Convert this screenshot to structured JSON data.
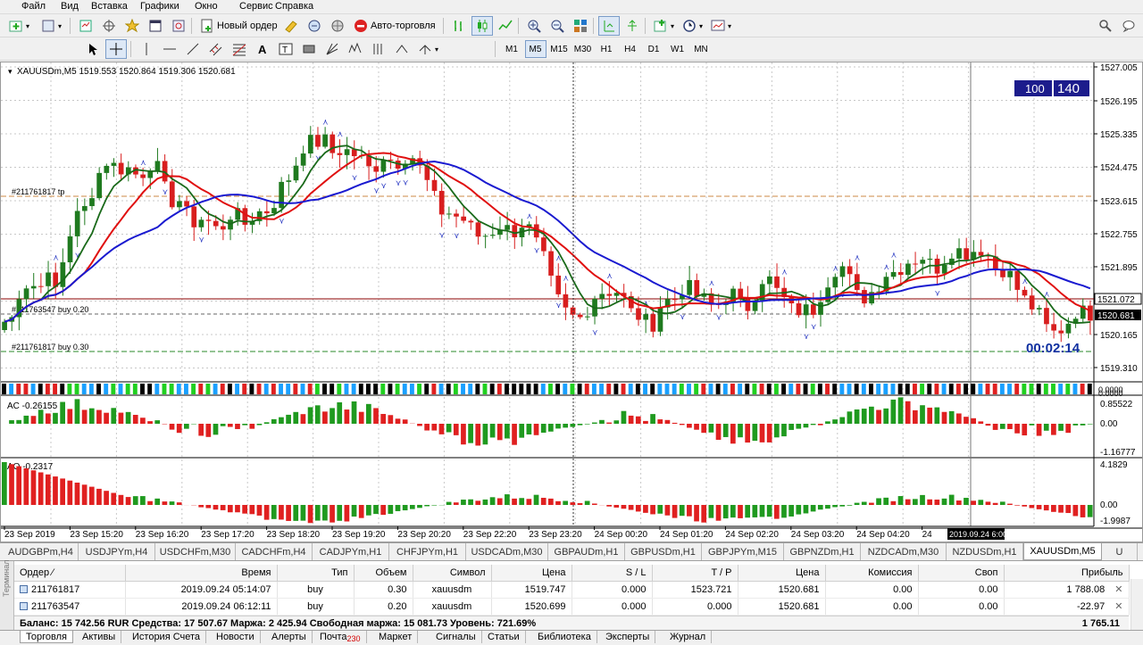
{
  "menu": [
    "Файл",
    "Вид",
    "Вставка",
    "Графики",
    "Окно",
    "Сервис",
    "Справка"
  ],
  "toolbar": {
    "new_order": "Новый ордер",
    "auto_trading": "Авто-торговля",
    "timeframes": [
      "M1",
      "M5",
      "M15",
      "M30",
      "H1",
      "H4",
      "D1",
      "W1",
      "MN"
    ],
    "active_timeframe": "M5"
  },
  "chart": {
    "header": "XAUUSDm,M5  1519.553 1520.864 1519.306 1520.681",
    "price_axis": [
      "1527.005",
      "1526.195",
      "1525.335",
      "1524.475",
      "1523.615",
      "1522.755",
      "1521.895",
      "1521.072",
      "1520.681",
      "1520.165",
      "1519.310"
    ],
    "current_price": "1521.072",
    "bid_price": "1520.681",
    "lots": [
      "100",
      "140"
    ],
    "countdown": "00:02:14",
    "order_labels": [
      "#211761817 tp",
      "#211763547 buy 0.20",
      "#211761817 buy 0.30"
    ],
    "time_axis": [
      "23 Sep 2019",
      "23 Sep 15:20",
      "23 Sep 16:20",
      "23 Sep 17:20",
      "23 Sep 18:20",
      "23 Sep 19:20",
      "23 Sep 20:20",
      "23 Sep 22:20",
      "23 Sep 23:20",
      "24 Sep 00:20",
      "24 Sep 01:20",
      "24 Sep 02:20",
      "24 Sep 03:20",
      "24 Sep 04:20",
      "24"
    ],
    "crosshair_time": "2019.09.24 6:00",
    "ac_label": "AC -0.26155",
    "ac_axis": [
      "0.85522",
      "0.00",
      "-1.16777"
    ],
    "ao_label": "AO -0.2317",
    "ao_axis": [
      "4.1829",
      "0.00",
      "-1.9987"
    ],
    "strip_axis": [
      "0.0000",
      "0.0000"
    ]
  },
  "symbol_tabs": [
    "AUDGBPm,H4",
    "USDJPYm,H4",
    "USDCHFm,M30",
    "CADCHFm,H4",
    "CADJPYm,H1",
    "CHFJPYm,H1",
    "USDCADm,M30",
    "GBPAUDm,H1",
    "GBPUSDm,H1",
    "GBPJPYm,M15",
    "GBPNZDm,H1",
    "NZDCADm,M30",
    "NZDUSDm,H1",
    "XAUUSDm,M5",
    "U"
  ],
  "active_symbol_tab": 13,
  "terminal": {
    "side_label": "Терминал",
    "columns": [
      "Ордер",
      "Время",
      "Тип",
      "Объем",
      "Символ",
      "Цена",
      "S / L",
      "T / P",
      "Цена",
      "Комиссия",
      "Своп",
      "Прибыль"
    ],
    "rows": [
      [
        "211761817",
        "2019.09.24 05:14:07",
        "buy",
        "0.30",
        "xauusdm",
        "1519.747",
        "0.000",
        "1523.721",
        "1520.681",
        "0.00",
        "0.00",
        "1 788.08"
      ],
      [
        "211763547",
        "2019.09.24 06:12:11",
        "buy",
        "0.20",
        "xauusdm",
        "1520.699",
        "0.000",
        "0.000",
        "1520.681",
        "0.00",
        "0.00",
        "-22.97"
      ]
    ],
    "balance": "Баланс: 15 742.56 RUR  Средства: 17 507.67  Маржа: 2 425.94  Свободная маржа: 15 081.73  Уровень: 721.69%",
    "total": "1 765.11"
  },
  "bottom_tabs": [
    "Торговля",
    "Активы",
    "История Счета",
    "Новости",
    "Алерты",
    "Почта",
    "Маркет",
    "Сигналы",
    "Статьи",
    "Библиотека",
    "Эксперты",
    "Журнал"
  ],
  "mail_badge": "230",
  "colors": {
    "bull": "#1f7a1f",
    "bear": "#d81e1e",
    "ma_blue": "#1a1ad0",
    "ma_red": "#e01010",
    "ma_green": "#1a6a1a",
    "countdown": "#1030a0",
    "label_bg": "#1c1c8c"
  }
}
